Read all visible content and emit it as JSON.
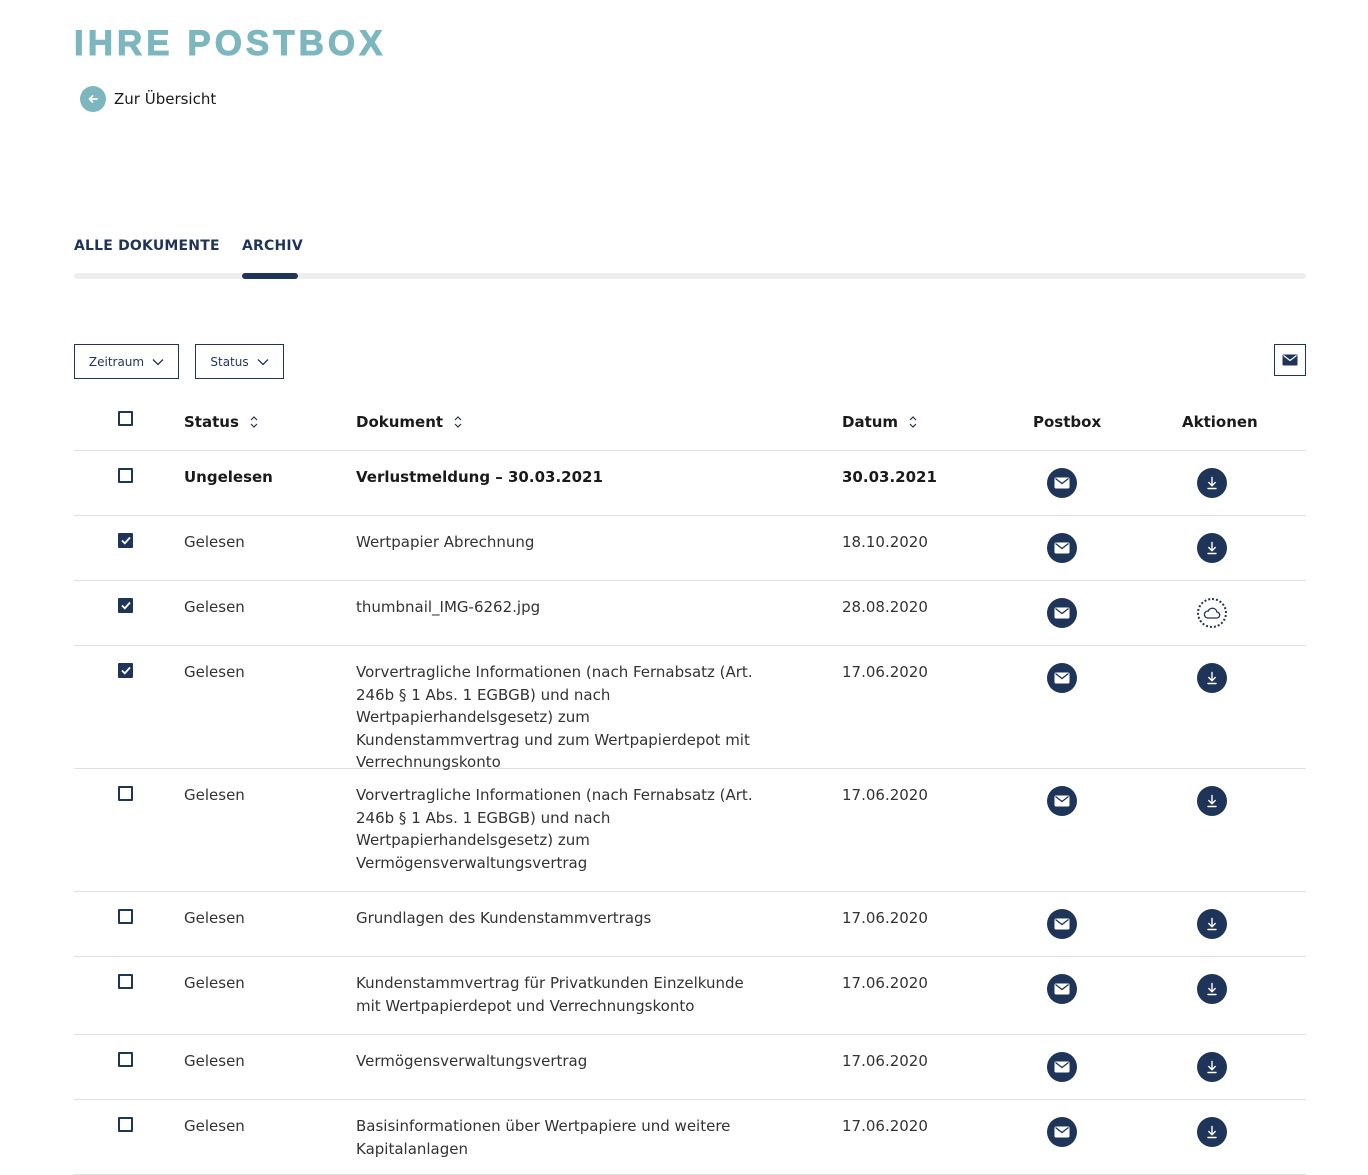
{
  "header": {
    "title": "IHRE POSTBOX",
    "back_label": "Zur Übersicht"
  },
  "tabs": [
    {
      "label": "ALLE DOKUMENTE",
      "active": false
    },
    {
      "label": "ARCHIV",
      "active": true
    }
  ],
  "filters": {
    "zeitraum": "Zeitraum",
    "status": "Status"
  },
  "columns": {
    "status": "Status",
    "dokument": "Dokument",
    "datum": "Datum",
    "postbox": "Postbox",
    "aktionen": "Aktionen"
  },
  "rows": [
    {
      "checked": false,
      "unread": true,
      "status": "Ungelesen",
      "document": "Verlustmeldung – 30.03.2021",
      "date": "30.03.2021",
      "action": "download-icon"
    },
    {
      "checked": true,
      "unread": false,
      "status": "Gelesen",
      "document": "Wertpapier Abrechnung",
      "date": "18.10.2020",
      "action": "download-icon"
    },
    {
      "checked": true,
      "unread": false,
      "status": "Gelesen",
      "document": "thumbnail_IMG-6262.jpg",
      "date": "28.08.2020",
      "action": "cloud-icon"
    },
    {
      "checked": true,
      "unread": false,
      "status": "Gelesen",
      "document": "Vorvertragliche Informationen (nach Fernabsatz (Art. 246b § 1 Abs. 1 EGBGB) und nach Wertpapierhandelsgesetz) zum Kundenstammvertrag und zum Wertpapierdepot mit Verrechnungskonto",
      "date": "17.06.2020",
      "action": "download-icon"
    },
    {
      "checked": false,
      "unread": false,
      "status": "Gelesen",
      "document": "Vorvertragliche Informationen (nach Fernabsatz (Art. 246b § 1 Abs. 1 EGBGB) und nach Wertpapierhandelsgesetz) zum Vermögensverwaltungsvertrag",
      "date": "17.06.2020",
      "action": "download-icon"
    },
    {
      "checked": false,
      "unread": false,
      "status": "Gelesen",
      "document": "Grundlagen des Kundenstammvertrags",
      "date": "17.06.2020",
      "action": "download-icon"
    },
    {
      "checked": false,
      "unread": false,
      "status": "Gelesen",
      "document": "Kundenstammvertrag für Privatkunden Einzelkunde mit Wertpapierdepot und Verrechnungskonto",
      "date": "17.06.2020",
      "action": "download-icon"
    },
    {
      "checked": false,
      "unread": false,
      "status": "Gelesen",
      "document": "Vermögensverwaltungsvertrag",
      "date": "17.06.2020",
      "action": "download-icon"
    },
    {
      "checked": false,
      "unread": false,
      "status": "Gelesen",
      "document": "Basisinformationen über Wertpapiere und weitere Kapitalanlagen",
      "date": "17.06.2020",
      "action": "download-icon"
    }
  ],
  "colors": {
    "accent": "#7cb7bf",
    "primary": "#1f3459"
  }
}
